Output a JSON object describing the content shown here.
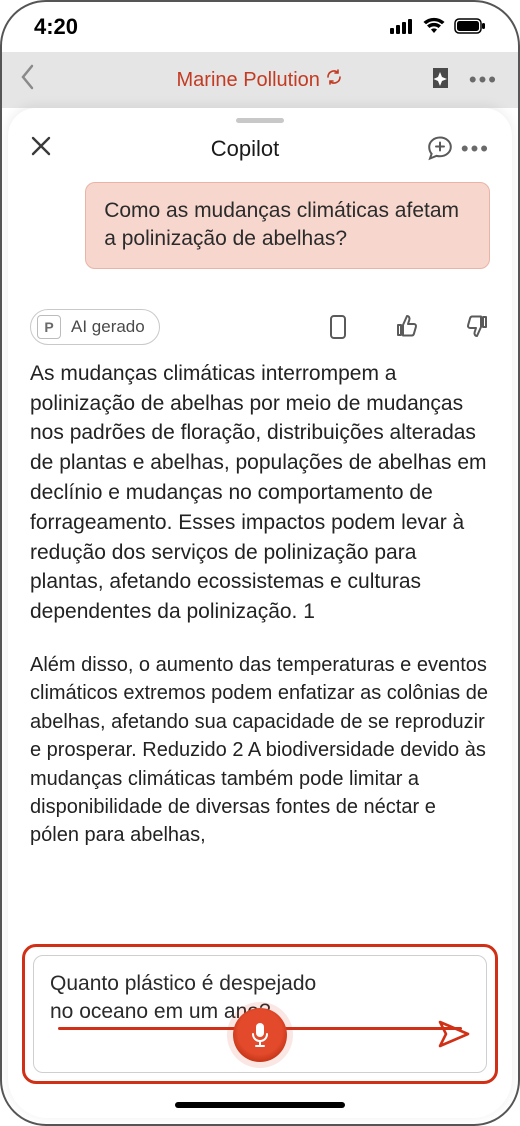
{
  "status": {
    "time": "4:20"
  },
  "background_app": {
    "title": "Marine Pollution"
  },
  "sheet": {
    "title": "Copilot",
    "user_message": "Como as mudanças climáticas afetam a polinização de abelhas?",
    "ai_badge_letter": "P",
    "ai_badge_label": "AI gerado",
    "ai_paragraph_1": "As mudanças climáticas interrompem a polinização de abelhas por meio de mudanças nos padrões de floração, distribuições alteradas de plantas e abelhas, populações de abelhas em declínio e mudanças no comportamento de forrageamento. Esses impactos podem levar à redução dos serviços de polinização para plantas, afetando ecossistemas e culturas dependentes da polinização. 1",
    "ai_paragraph_2": "Além disso, o aumento das temperaturas e eventos climáticos extremos podem enfatizar as colônias de abelhas, afetando sua capacidade de se reproduzir e prosperar.   Reduzido 2 A biodiversidade devido às mudanças climáticas também pode limitar a disponibilidade de diversas fontes de néctar e pólen para abelhas,"
  },
  "input": {
    "text": "Quanto plástico é despejado\nno oceano em um ano?"
  }
}
